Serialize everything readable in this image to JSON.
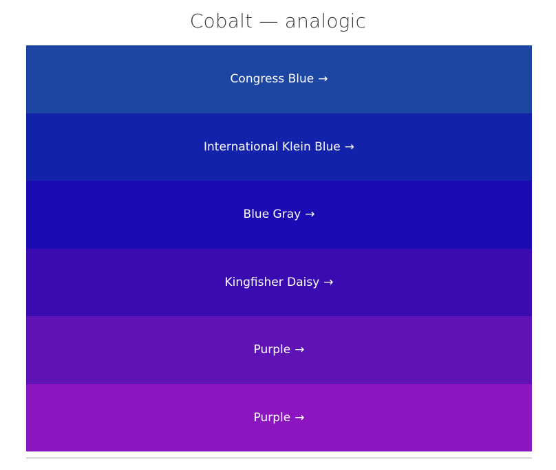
{
  "title": "Cobalt — analogic",
  "arrow_glyph": "→",
  "swatches": [
    {
      "label": "Congress Blue",
      "color": "#1d46a3"
    },
    {
      "label": "International Klein Blue",
      "color": "#1322aa"
    },
    {
      "label": "Blue Gray",
      "color": "#1a0bb3"
    },
    {
      "label": "Kingfisher Daisy",
      "color": "#3a0bb0"
    },
    {
      "label": "Purple",
      "color": "#5f12b5"
    },
    {
      "label": "Purple",
      "color": "#8b15be"
    }
  ]
}
